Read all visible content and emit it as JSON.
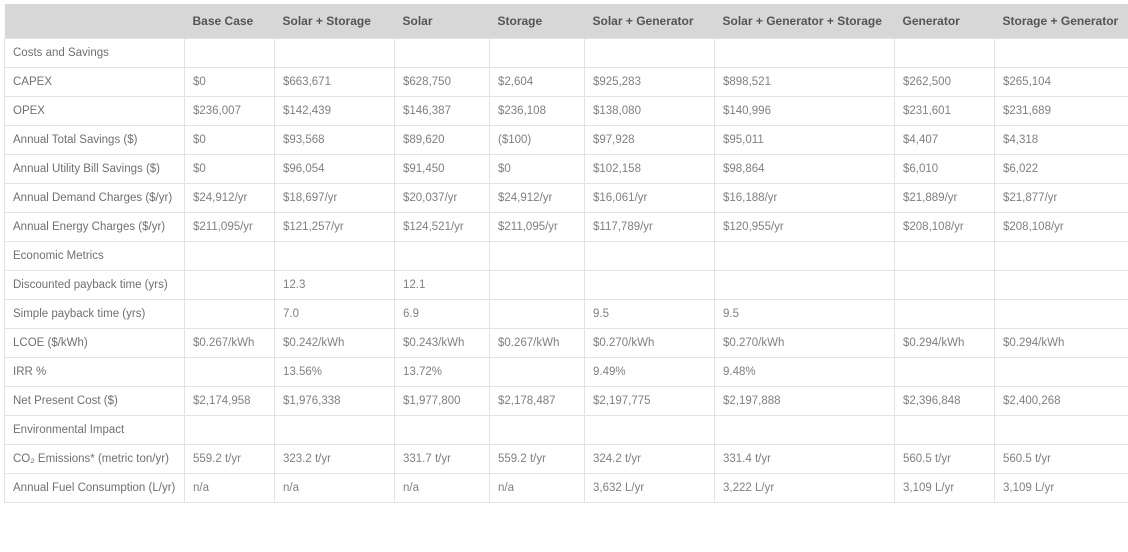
{
  "columns": [
    "",
    "Base Case",
    "Solar + Storage",
    "Solar",
    "Storage",
    "Solar + Generator",
    "Solar + Generator + Storage",
    "Generator",
    "Storage + Generator"
  ],
  "sections": [
    {
      "title": "Costs and Savings",
      "rows": [
        {
          "label": "CAPEX",
          "values": [
            "$0",
            "$663,671",
            "$628,750",
            "$2,604",
            "$925,283",
            "$898,521",
            "$262,500",
            "$265,104"
          ]
        },
        {
          "label": "OPEX",
          "values": [
            "$236,007",
            "$142,439",
            "$146,387",
            "$236,108",
            "$138,080",
            "$140,996",
            "$231,601",
            "$231,689"
          ]
        },
        {
          "label": "Annual Total Savings ($)",
          "values": [
            "$0",
            "$93,568",
            "$89,620",
            "($100)",
            "$97,928",
            "$95,011",
            "$4,407",
            "$4,318"
          ]
        },
        {
          "label": "Annual Utility Bill Savings ($)",
          "values": [
            "$0",
            "$96,054",
            "$91,450",
            "$0",
            "$102,158",
            "$98,864",
            "$6,010",
            "$6,022"
          ]
        },
        {
          "label": "Annual Demand Charges ($/yr)",
          "values": [
            "$24,912/yr",
            "$18,697/yr",
            "$20,037/yr",
            "$24,912/yr",
            "$16,061/yr",
            "$16,188/yr",
            "$21,889/yr",
            "$21,877/yr"
          ]
        },
        {
          "label": "Annual Energy Charges ($/yr)",
          "values": [
            "$211,095/yr",
            "$121,257/yr",
            "$124,521/yr",
            "$211,095/yr",
            "$117,789/yr",
            "$120,955/yr",
            "$208,108/yr",
            "$208,108/yr"
          ]
        }
      ]
    },
    {
      "title": "Economic Metrics",
      "rows": [
        {
          "label": "Discounted payback time (yrs)",
          "values": [
            "",
            "12.3",
            "12.1",
            "",
            "",
            "",
            "",
            ""
          ]
        },
        {
          "label": "Simple payback time (yrs)",
          "values": [
            "",
            "7.0",
            "6.9",
            "",
            "9.5",
            "9.5",
            "",
            ""
          ]
        },
        {
          "label": "LCOE ($/kWh)",
          "values": [
            "$0.267/kWh",
            "$0.242/kWh",
            "$0.243/kWh",
            "$0.267/kWh",
            "$0.270/kWh",
            "$0.270/kWh",
            "$0.294/kWh",
            "$0.294/kWh"
          ]
        },
        {
          "label": "IRR %",
          "values": [
            "",
            "13.56%",
            "13.72%",
            "",
            "9.49%",
            "9.48%",
            "",
            ""
          ]
        },
        {
          "label": "Net Present Cost ($)",
          "values": [
            "$2,174,958",
            "$1,976,338",
            "$1,977,800",
            "$2,178,487",
            "$2,197,775",
            "$2,197,888",
            "$2,396,848",
            "$2,400,268"
          ]
        }
      ]
    },
    {
      "title": "Environmental Impact",
      "rows": [
        {
          "label": "CO₂ Emissions* (metric ton/yr)",
          "values": [
            "559.2 t/yr",
            "323.2 t/yr",
            "331.7 t/yr",
            "559.2 t/yr",
            "324.2 t/yr",
            "331.4 t/yr",
            "560.5 t/yr",
            "560.5 t/yr"
          ]
        },
        {
          "label": "Annual Fuel Consumption (L/yr)",
          "values": [
            "n/a",
            "n/a",
            "n/a",
            "n/a",
            "3,632 L/yr",
            "3,222 L/yr",
            "3,109 L/yr",
            "3,109 L/yr"
          ]
        }
      ]
    }
  ]
}
